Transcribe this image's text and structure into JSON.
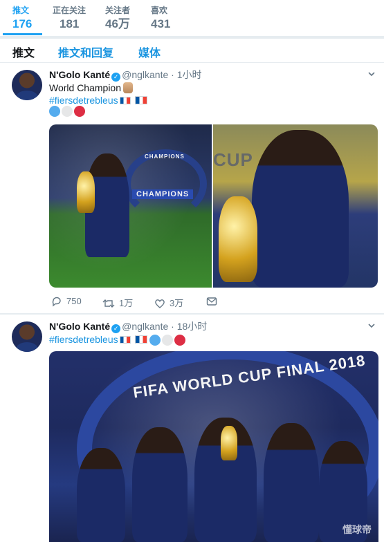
{
  "profile_nav": {
    "items": [
      {
        "label": "推文",
        "value": "176"
      },
      {
        "label": "正在关注",
        "value": "181"
      },
      {
        "label": "关注者",
        "value": "46万"
      },
      {
        "label": "喜欢",
        "value": "431"
      }
    ]
  },
  "tabs": [
    "推文",
    "推文和回复",
    "媒体"
  ],
  "tweets": [
    {
      "name": "N'Golo Kanté",
      "handle": "@nglkante",
      "separator": "·",
      "time": "1小时",
      "text": "World Champion",
      "hashtag": "#fiersdetrebleus",
      "actions": {
        "replies": "750",
        "retweets": "1万",
        "likes": "3万"
      },
      "photo_banners": [
        "CHAMPIONS",
        "CHAMPIONS",
        "CUP"
      ]
    },
    {
      "name": "N'Golo Kanté",
      "handle": "@nglkante",
      "separator": "·",
      "time": "18小时",
      "hashtag": "#fiersdetrebleus",
      "photo_banner": "FIFA WORLD CUP FINAL 2018"
    }
  ],
  "watermark": "懂球帝",
  "icons": [
    "verified-icon",
    "caret-down-icon",
    "reply-icon",
    "retweet-icon",
    "like-icon",
    "message-icon"
  ],
  "colors": {
    "accent": "#1da1f2",
    "link": "#1b95e0",
    "muted": "#657786",
    "background": "#e6ecf0"
  }
}
